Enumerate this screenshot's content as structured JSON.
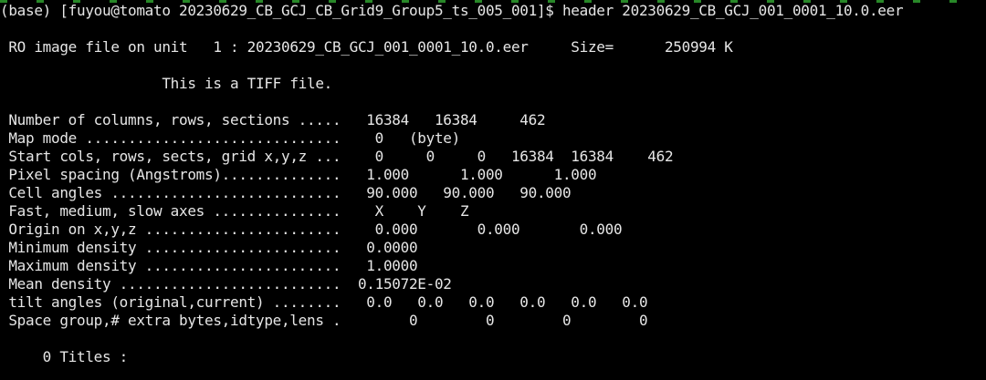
{
  "terminal": {
    "background": "#000000",
    "text_color": "#e6e6e6",
    "prompt": "(base) [fuyou@tomato 20230629_CB_GCJ_CB_Grid9_Group5_ts_005_001]$ header 20230629_CB_GCJ_001_0001_10.0.eer",
    "ro_line": " RO image file on unit   1 : 20230629_CB_GCJ_001_0001_10.0.eer     Size=      250994 K",
    "tiff_line": "                   This is a TIFF file.",
    "header_lines": [
      " Number of columns, rows, sections .....   16384   16384     462",
      " Map mode ..............................    0   (byte)",
      " Start cols, rows, sects, grid x,y,z ...    0     0     0   16384  16384    462",
      " Pixel spacing (Angstroms)..............   1.000      1.000      1.000",
      " Cell angles ...........................   90.000   90.000   90.000",
      " Fast, medium, slow axes ...............    X    Y    Z",
      " Origin on x,y,z .......................    0.000       0.000       0.000",
      " Minimum density .......................   0.0000",
      " Maximum density .......................   1.0000",
      " Mean density ..........................  0.15072E-02",
      " tilt angles (original,current) ........   0.0   0.0   0.0   0.0   0.0   0.0",
      " Space group,# extra bytes,idtype,lens .        0        0        0        0"
    ],
    "titles_line": "     0 Titles :"
  }
}
